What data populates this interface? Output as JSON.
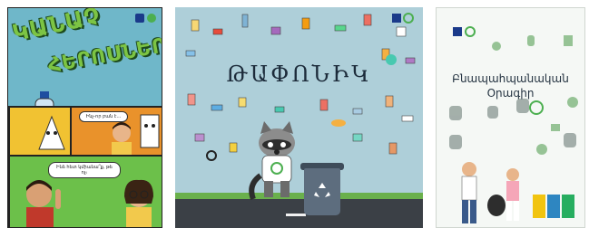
{
  "covers": [
    {
      "title_line1": "ԿԱՆԱՉ",
      "title_line2": "ՀԵՐՈՍՆԵՐԸ",
      "bubble_1": "Ինչ-որ բան է...",
      "bubble_2": "Ինձ հետ կմիանա՞ք, թե ոչ։",
      "bubble_3": "Ինչպե՞ս հավաքենք, ինչպե՞ս թեթևանանք"
    },
    {
      "title": "ԹԱՓՈՆԻԿ"
    },
    {
      "title_line1": "Բնապահպանական",
      "title_line2": "Օրագիր"
    }
  ],
  "colors": {
    "comic_bg": "#6fb7c9",
    "comic_title": "#7cc444",
    "raccoon_bg": "#aecfd9",
    "guide_bg": "#f5f8f5",
    "accent_green": "#4caf50"
  }
}
